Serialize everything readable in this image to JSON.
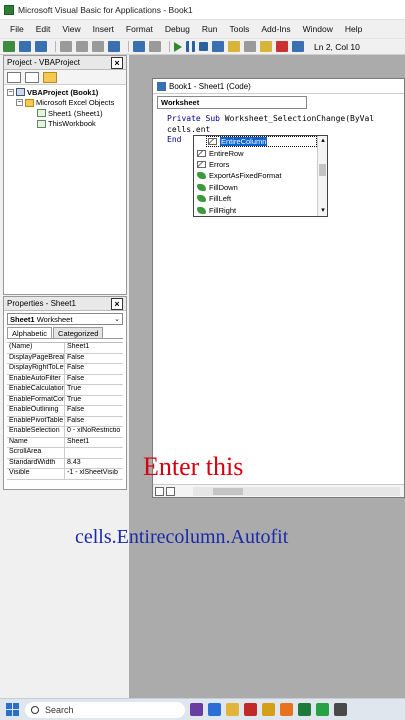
{
  "window": {
    "title": "Microsoft Visual Basic for Applications - Book1"
  },
  "menu": [
    "File",
    "Edit",
    "View",
    "Insert",
    "Format",
    "Debug",
    "Run",
    "Tools",
    "Add-Ins",
    "Window",
    "Help"
  ],
  "toolbar": {
    "position": "Ln 2, Col 10"
  },
  "project": {
    "header": "Project - VBAProject",
    "close": "×",
    "tree": {
      "root": "VBAProject (Book1)",
      "folder": "Microsoft Excel Objects",
      "sheet": "Sheet1 (Sheet1)",
      "workbook": "ThisWorkbook"
    }
  },
  "properties": {
    "header": "Properties - Sheet1",
    "close": "×",
    "object": "Sheet1",
    "object_type": "Worksheet",
    "tabs": [
      "Alphabetic",
      "Categorized"
    ],
    "rows": [
      {
        "name": "(Name)",
        "value": "Sheet1"
      },
      {
        "name": "DisplayPageBreak",
        "value": "False"
      },
      {
        "name": "DisplayRightToLef",
        "value": "False"
      },
      {
        "name": "EnableAutoFilter",
        "value": "False"
      },
      {
        "name": "EnableCalculation",
        "value": "True"
      },
      {
        "name": "EnableFormatCon",
        "value": "True"
      },
      {
        "name": "EnableOutlining",
        "value": "False"
      },
      {
        "name": "EnablePivotTable",
        "value": "False"
      },
      {
        "name": "EnableSelection",
        "value": "0 - xlNoRestrictio"
      },
      {
        "name": "Name",
        "value": "Sheet1"
      },
      {
        "name": "ScrollArea",
        "value": ""
      },
      {
        "name": "StandardWidth",
        "value": "8.43"
      },
      {
        "name": "Visible",
        "value": "-1 - xlSheetVisib"
      }
    ]
  },
  "codewindow": {
    "title": "Book1 - Sheet1 (Code)",
    "object": "Worksheet",
    "lines": [
      {
        "kw": "Private Sub ",
        "rest": "Worksheet_SelectionChange(ByVal"
      },
      {
        "kw": "",
        "rest": "cells.ent"
      },
      {
        "kw": "End",
        "rest": ""
      }
    ]
  },
  "autocomplete": {
    "items": [
      {
        "label": "EntireColumn",
        "kind": "prop",
        "selected": true
      },
      {
        "label": "EntireRow",
        "kind": "prop"
      },
      {
        "label": "Errors",
        "kind": "prop"
      },
      {
        "label": "ExportAsFixedFormat",
        "kind": "meth"
      },
      {
        "label": "FillDown",
        "kind": "meth"
      },
      {
        "label": "FillLeft",
        "kind": "meth"
      },
      {
        "label": "FillRight",
        "kind": "meth"
      }
    ]
  },
  "captions": {
    "instruction": "Enter this",
    "code": "cells.Entirecolumn.Autofit"
  },
  "taskbar": {
    "search_placeholder": "Search"
  },
  "colors": {
    "caption_red": "#d6000f",
    "caption_blue": "#1b2aa8",
    "selection_blue": "#0a64d0"
  }
}
